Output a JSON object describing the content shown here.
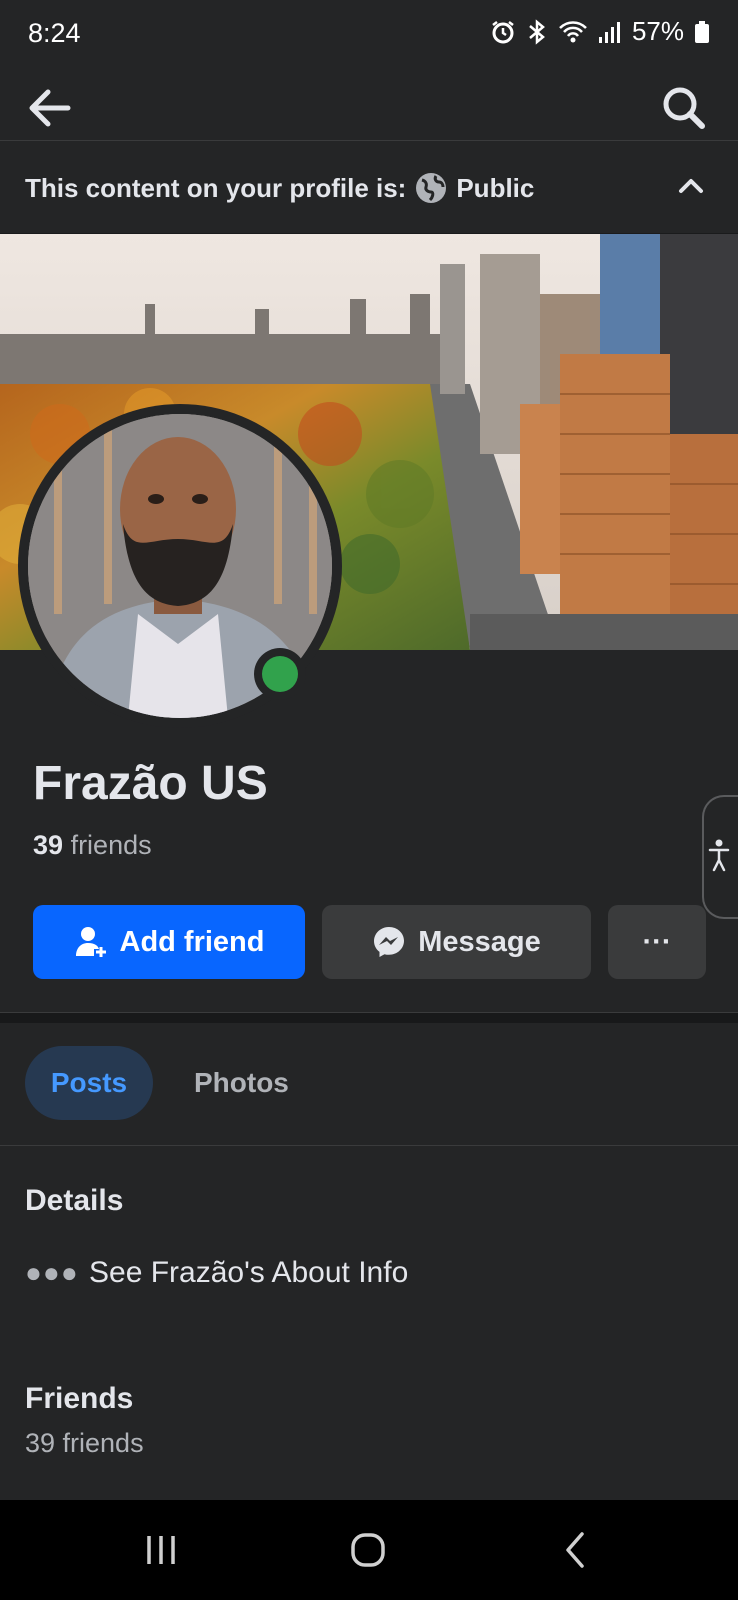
{
  "status_bar": {
    "time": "8:24",
    "battery": "57%"
  },
  "banner": {
    "prefix": "This content on your profile is:",
    "privacy": "Public"
  },
  "profile": {
    "name": "Frazão US",
    "friends_count": "39",
    "friends_label": "friends"
  },
  "actions": {
    "add_friend": "Add friend",
    "message": "Message",
    "more": "···"
  },
  "tabs": [
    {
      "label": "Posts",
      "selected": true
    },
    {
      "label": "Photos",
      "selected": false
    }
  ],
  "details": {
    "title": "Details",
    "about": "See Frazão's About Info"
  },
  "friends_section": {
    "title": "Friends",
    "count": "39 friends"
  },
  "colors": {
    "accent": "#0866ff",
    "online": "#31a24c",
    "tab_selected_bg": "#263951",
    "tab_selected_text": "#4599ff"
  }
}
